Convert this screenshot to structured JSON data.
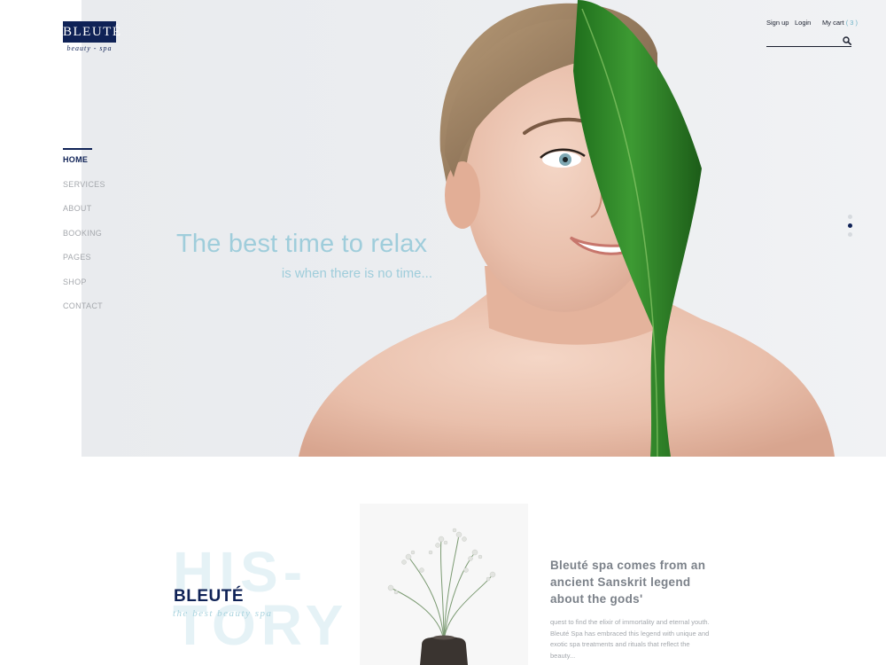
{
  "brand": {
    "logo_text": "BLEUTÉ",
    "logo_tagline": "beauty - spa"
  },
  "nav": {
    "items": [
      {
        "label": "HOME",
        "active": true
      },
      {
        "label": "SERVICES",
        "active": false
      },
      {
        "label": "ABOUT",
        "active": false
      },
      {
        "label": "BOOKING",
        "active": false
      },
      {
        "label": "PAGES",
        "active": false
      },
      {
        "label": "SHOP",
        "active": false
      },
      {
        "label": "CONTACT",
        "active": false
      }
    ]
  },
  "header": {
    "signup_label": "Sign up",
    "login_label": "Login",
    "cart_label": "My cart",
    "cart_count": "( 3 )",
    "search_placeholder": ""
  },
  "hero": {
    "title": "The best time to relax",
    "subtitle": "is when there is no time...",
    "slide_count": 3,
    "active_slide": 2
  },
  "history": {
    "background_word_line1": "HIS-",
    "background_word_line2": "TORY",
    "brand_title": "BLEUTÉ",
    "brand_subtitle": "the best beauty spa",
    "heading": "Bleuté spa comes from an ancient Sanskrit legend about the gods'",
    "body": "quest to find the elixir of immortality and eternal youth. Bleuté Spa has embraced this legend with unique and exotic spa treatments and rituals that reflect the beauty..."
  },
  "colors": {
    "brand_navy": "#0f2256",
    "accent_light_blue": "#9fcddb",
    "nav_inactive": "#a5a8ad",
    "leaf_green": "#2f8a2a"
  }
}
